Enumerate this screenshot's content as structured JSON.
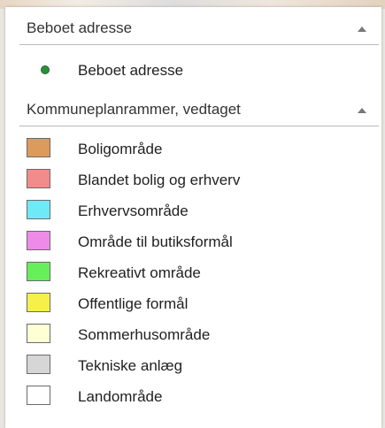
{
  "sections": [
    {
      "title": "Beboet adresse",
      "items": [
        {
          "label": "Beboet adresse",
          "symbol": "point",
          "color": "#2b8f3a"
        }
      ]
    },
    {
      "title": "Kommuneplanrammer, vedtaget",
      "items": [
        {
          "label": "Boligområde",
          "color": "#dc9a5c"
        },
        {
          "label": "Blandet bolig og erhverv",
          "color": "#f28b8b"
        },
        {
          "label": "Erhvervsområde",
          "color": "#6fe9f5"
        },
        {
          "label": "Område til butiksformål",
          "color": "#ee8be9"
        },
        {
          "label": "Rekreativt område",
          "color": "#66ef5a"
        },
        {
          "label": "Offentlige formål",
          "color": "#f5f04a"
        },
        {
          "label": "Sommerhusområde",
          "color": "#ffffd6"
        },
        {
          "label": "Tekniske anlæg",
          "color": "#d6d6d6"
        },
        {
          "label": "Landområde",
          "color": "#ffffff"
        }
      ]
    }
  ]
}
